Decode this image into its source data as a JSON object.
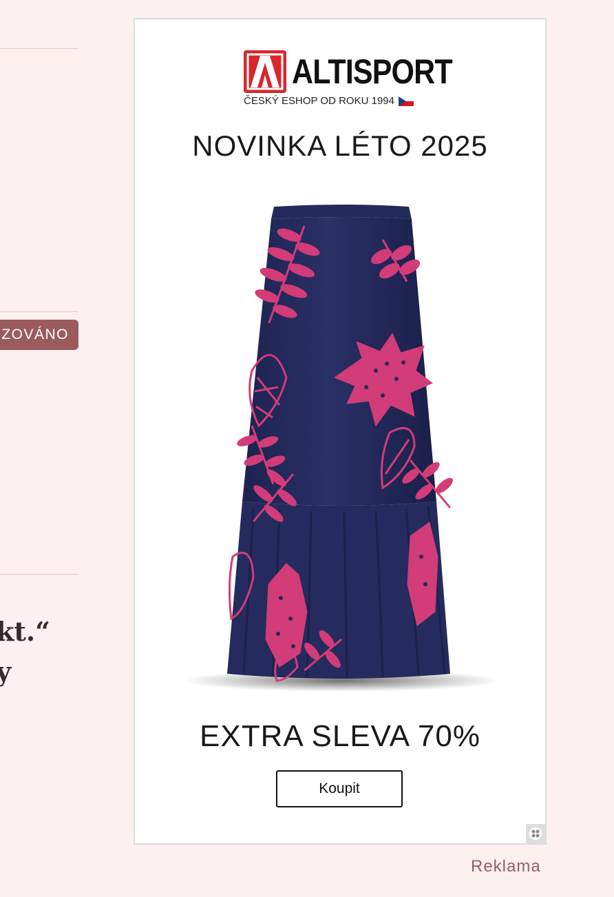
{
  "left_column": {
    "badge_text": "ZOVÁNO",
    "quote_lines": [
      "kt.“",
      "y"
    ]
  },
  "ad": {
    "brand_name": "ALTISPORT",
    "brand_tagline": "ČESKÝ ESHOP OD ROKU 1994",
    "headline": "NOVINKA LÉTO 2025",
    "offer": "EXTRA SLEVA 70%",
    "button_label": "Koupit",
    "brand_color": "#d8262d",
    "product": {
      "description_icon": "skirt-product-image",
      "fabric_color": "#23295a",
      "print_color": "#d23c78"
    },
    "adchoices_icon": "adchoices-icon"
  },
  "ad_label": "Reklama",
  "colors": {
    "page_background": "#fcf0f1",
    "accent": "#9b5b5d",
    "divider": "#e8c4c6"
  }
}
